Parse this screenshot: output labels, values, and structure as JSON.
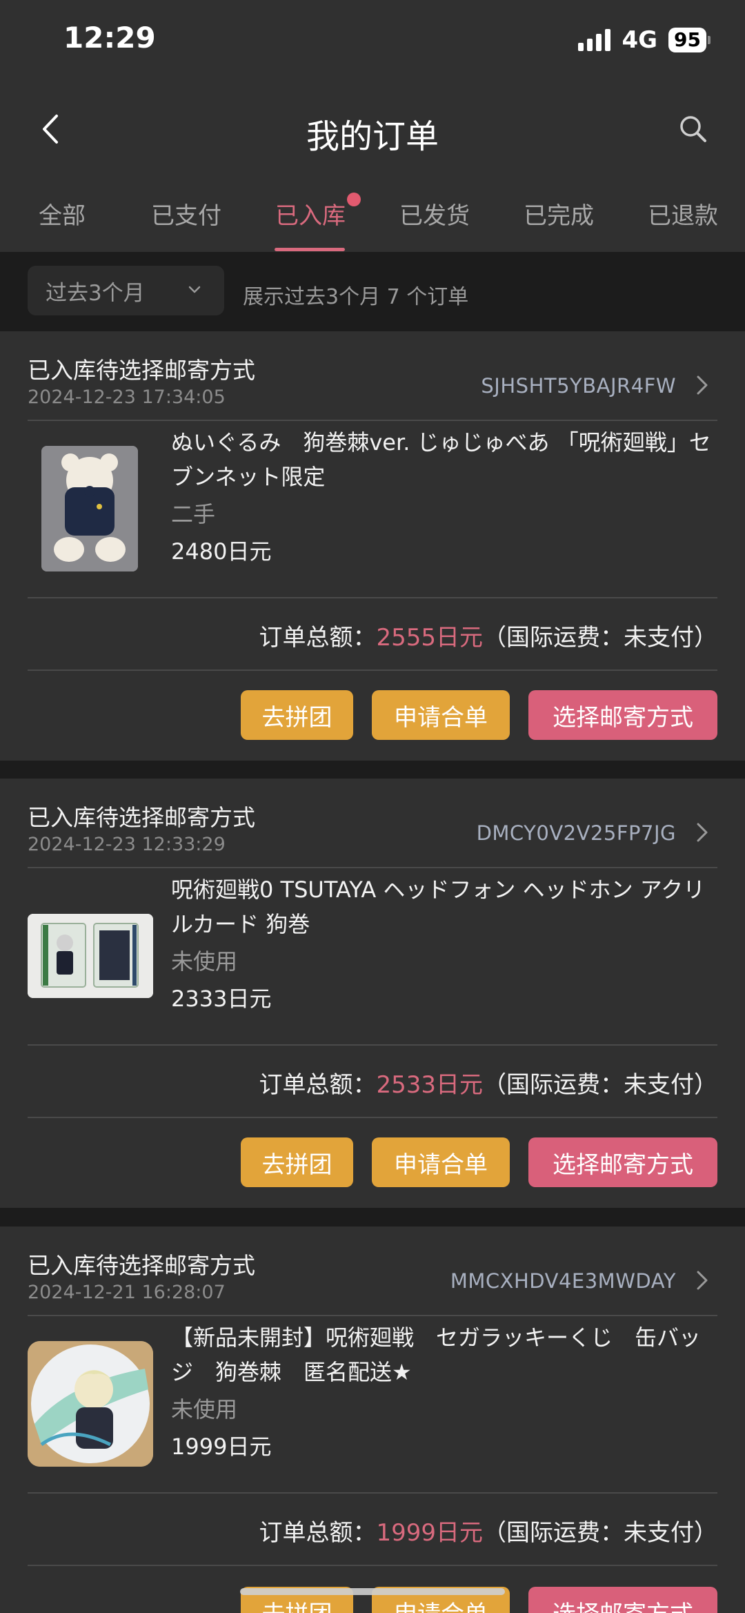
{
  "status_bar": {
    "time": "12:29",
    "network": "4G",
    "battery": "95"
  },
  "nav": {
    "title": "我的订单"
  },
  "tabs": [
    "全部",
    "已支付",
    "已入库",
    "已发货",
    "已完成",
    "已退款"
  ],
  "active_tab": "已入库",
  "filter": {
    "period": "过去3个月",
    "summary": "展示过去3个月 7 个订单"
  },
  "orders": [
    {
      "status": "已入库待选择邮寄方式",
      "time": "2024-12-23 17:34:05",
      "id": "SJHSHT5YBAJR4FW",
      "product_title": "ぬいぐるみ　狗巻棘ver. じゅじゅべあ 「呪術廻戦」セブンネット限定",
      "condition": "二手",
      "price": "2480日元",
      "total_label": "订单总额：",
      "total_amount": "2555日元",
      "shipping_note": "（国际运费：未支付）",
      "buttons": {
        "group": "去拼团",
        "merge": "申请合单",
        "ship": "选择邮寄方式"
      }
    },
    {
      "status": "已入库待选择邮寄方式",
      "time": "2024-12-23 12:33:29",
      "id": "DMCY0V2V25FP7JG",
      "product_title": "呪術廻戦0 TSUTAYA ヘッドフォン ヘッドホン アクリルカード 狗巻",
      "condition": "未使用",
      "price": "2333日元",
      "total_label": "订单总额：",
      "total_amount": "2533日元",
      "shipping_note": "（国际运费：未支付）",
      "buttons": {
        "group": "去拼团",
        "merge": "申请合单",
        "ship": "选择邮寄方式"
      }
    },
    {
      "status": "已入库待选择邮寄方式",
      "time": "2024-12-21 16:28:07",
      "id": "MMCXHDV4E3MWDAY",
      "product_title": "【新品未開封】呪術廻戦　セガラッキーくじ　缶バッジ　狗巻棘　匿名配送★",
      "condition": "未使用",
      "price": "1999日元",
      "total_label": "订单总额：",
      "total_amount": "1999日元",
      "shipping_note": "（国际运费：未支付）",
      "buttons": {
        "group": "去拼团",
        "merge": "申请合单",
        "ship": "选择邮寄方式"
      }
    }
  ],
  "colors": {
    "accent": "#d96a7e",
    "button_yellow": "#e2a43a",
    "button_pink": "#d9607a",
    "card_bg": "#303030"
  },
  "icons": {
    "back": "chevron-left-icon",
    "search": "search-icon",
    "dropdown": "chevron-down-icon",
    "detail": "chevron-right-icon"
  }
}
